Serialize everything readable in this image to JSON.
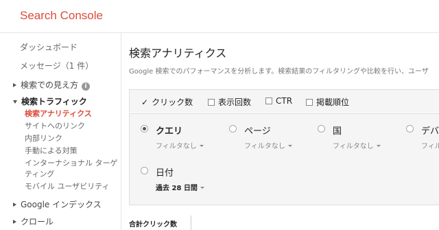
{
  "app": {
    "title": "Search Console",
    "brand_color": "#dd4b39"
  },
  "sidebar": {
    "dashboard": "ダッシュボード",
    "messages": "メッセージ（1 件）",
    "search_appearance": "検索での見え方",
    "search_traffic": "検索トラフィック",
    "traffic_items": [
      "検索アナリティクス",
      "サイトへのリンク",
      "内部リンク",
      "手動による対策",
      "インターナショナル ターゲ",
      "ティング",
      "モバイル ユーザビリティ"
    ],
    "google_index": "Google インデックス",
    "crawl": "クロール",
    "info_icon": "info-icon"
  },
  "main": {
    "title": "検索アナリティクス",
    "description": "Google 検索でのパフォーマンスを分析します。検索結果のフィルタリングや比較を行い、ユーザ",
    "metrics": [
      {
        "label": "クリック数",
        "checked": true
      },
      {
        "label": "表示回数",
        "checked": false
      },
      {
        "label": "CTR",
        "checked": false
      },
      {
        "label": "掲載順位",
        "checked": false
      }
    ],
    "groups": [
      {
        "label": "クエリ",
        "filter": "フィルタなし",
        "selected": true
      },
      {
        "label": "ページ",
        "filter": "フィルタなし",
        "selected": false
      },
      {
        "label": "国",
        "filter": "フィルタなし",
        "selected": false
      },
      {
        "label": "デバ",
        "filter": "フィル",
        "selected": false
      },
      {
        "label": "日付",
        "filter": "過去 28 日間",
        "selected": false
      }
    ],
    "total_clicks_label": "合計クリック数"
  }
}
